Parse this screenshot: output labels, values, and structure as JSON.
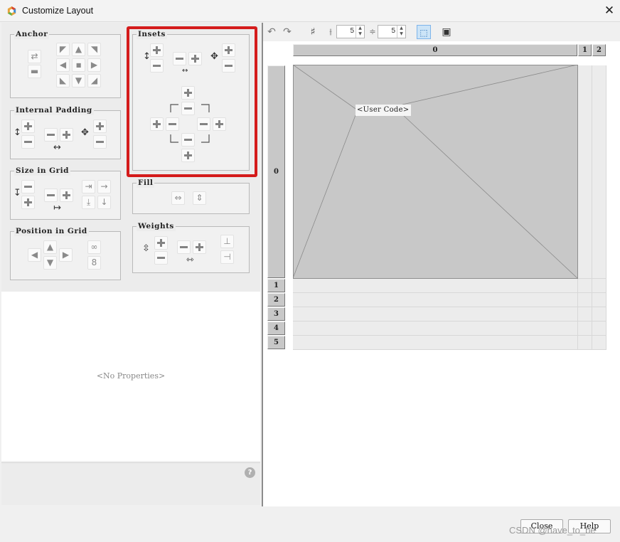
{
  "window": {
    "title": "Customize Layout",
    "close_glyph": "✕",
    "app_icon": "app-hex-icon"
  },
  "groups": {
    "anchor": "Anchor",
    "internal_padding": "Internal Padding",
    "size_in_grid": "Size in Grid",
    "position_in_grid": "Position in Grid",
    "insets": "Insets",
    "fill": "Fill",
    "weights": "Weights"
  },
  "properties": {
    "empty_text": "<No Properties>"
  },
  "help_glyph": "?",
  "toolbar": {
    "hgap_value": "5",
    "vgap_value": "5",
    "icons": [
      "undo-icon",
      "redo-icon",
      "grid-icon",
      "horizontal-gap-icon",
      "vertical-gap-icon",
      "select-icon",
      "preview-icon"
    ]
  },
  "grid": {
    "columns": [
      "0",
      "1",
      "2"
    ],
    "rows": [
      "0",
      "1",
      "2",
      "3",
      "4",
      "5"
    ],
    "component_label": "<User Code>"
  },
  "buttons": {
    "close": "Close",
    "help": "Help"
  },
  "watermark": "CSDN @have_to_be",
  "colors": {
    "highlight": "#d41b1b",
    "grid_header": "#c8c8c8",
    "component": "#c8c8c8"
  }
}
